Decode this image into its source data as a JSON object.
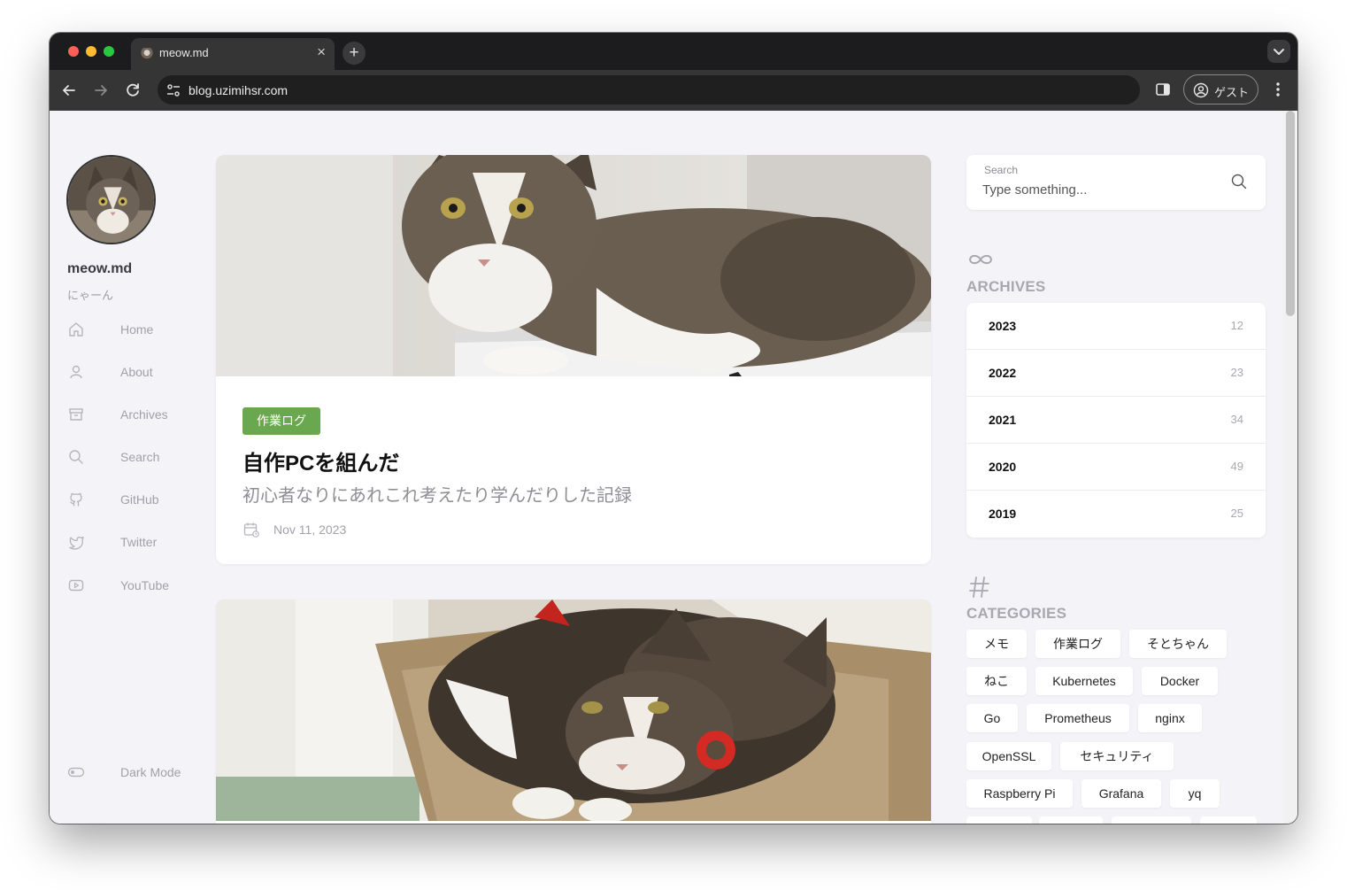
{
  "browser": {
    "tab_title": "meow.md",
    "tab_close": "×",
    "new_tab": "+",
    "url": "blog.uzimihsr.com",
    "profile_label": "ゲスト"
  },
  "sidebar": {
    "site_title": "meow.md",
    "tagline": "にゃーん",
    "nav": [
      {
        "label": "Home",
        "icon": "home-icon"
      },
      {
        "label": "About",
        "icon": "user-icon"
      },
      {
        "label": "Archives",
        "icon": "archive-icon"
      },
      {
        "label": "Search",
        "icon": "search-icon"
      },
      {
        "label": "GitHub",
        "icon": "github-icon"
      },
      {
        "label": "Twitter",
        "icon": "twitter-icon"
      },
      {
        "label": "YouTube",
        "icon": "youtube-icon"
      }
    ],
    "dark_mode_label": "Dark Mode"
  },
  "posts": [
    {
      "category": "作業ログ",
      "title": "自作PCを組んだ",
      "subtitle": "初心者なりにあれこれ考えたり学んだりした記録",
      "date": "Nov 11, 2023"
    }
  ],
  "search": {
    "label": "Search",
    "placeholder": "Type something..."
  },
  "archives": {
    "heading": "ARCHIVES",
    "rows": [
      {
        "year": "2023",
        "count": "12"
      },
      {
        "year": "2022",
        "count": "23"
      },
      {
        "year": "2021",
        "count": "34"
      },
      {
        "year": "2020",
        "count": "49"
      },
      {
        "year": "2019",
        "count": "25"
      }
    ]
  },
  "categories": {
    "heading": "CATEGORIES",
    "items": [
      "メモ",
      "作業ログ",
      "そとちゃん",
      "ねこ",
      "Kubernetes",
      "Docker",
      "Go",
      "Prometheus",
      "nginx",
      "OpenSSL",
      "セキュリティ",
      "Raspberry Pi",
      "Grafana",
      "yq"
    ]
  },
  "colors": {
    "accent_green": "#6aa84f",
    "page_bg": "#f4f3f8",
    "chrome_dark": "#1c1c1e"
  }
}
